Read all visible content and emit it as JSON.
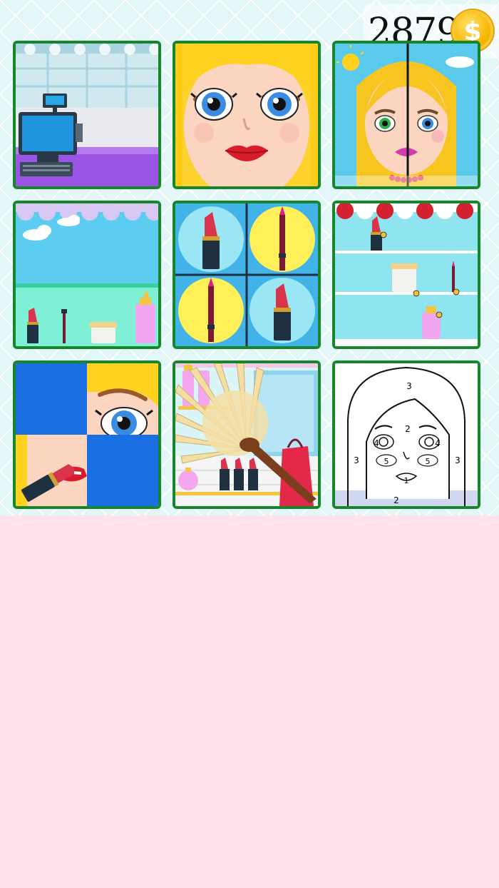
{
  "currency": {
    "coins": "2879",
    "icon": "gold-dollar-coin-icon"
  },
  "levels": [
    {
      "id": "cashier",
      "icon": "cash-register-icon"
    },
    {
      "id": "face-makeup",
      "icon": "girl-face-icon"
    },
    {
      "id": "half-makeover",
      "icon": "split-face-icon"
    },
    {
      "id": "shop-shelf",
      "icon": "cosmetics-shelf-icon"
    },
    {
      "id": "match-pairs",
      "icon": "lipstick-pencil-grid-icon"
    },
    {
      "id": "store-shelves",
      "icon": "store-shelves-icon"
    },
    {
      "id": "puzzle",
      "icon": "lipstick-puzzle-icon"
    },
    {
      "id": "cleaning",
      "icon": "feather-duster-icon"
    },
    {
      "id": "color-by-number",
      "icon": "coloring-page-icon"
    }
  ],
  "coloring_numbers": [
    "3",
    "2",
    "4",
    "4",
    "3",
    "3",
    "5",
    "5",
    "1",
    "2"
  ],
  "colors": {
    "tile_border": "#16862a",
    "top_background": "#e4f7f8",
    "bottom_background": "#ffe3ea",
    "coin": "#f7b500"
  }
}
